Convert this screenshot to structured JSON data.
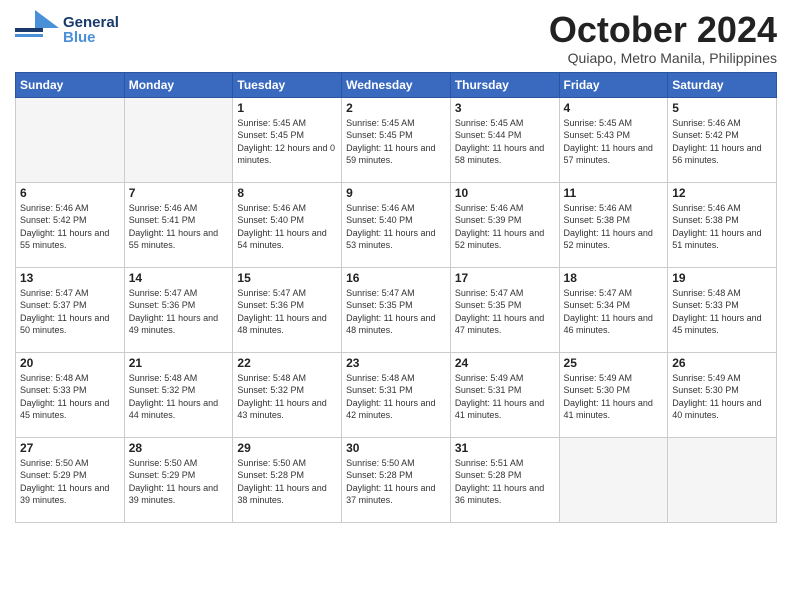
{
  "header": {
    "logo_general": "General",
    "logo_blue": "Blue",
    "title": "October 2024",
    "location": "Quiapo, Metro Manila, Philippines"
  },
  "weekdays": [
    "Sunday",
    "Monday",
    "Tuesday",
    "Wednesday",
    "Thursday",
    "Friday",
    "Saturday"
  ],
  "weeks": [
    [
      {
        "day": "",
        "sunrise": "",
        "sunset": "",
        "daylight": ""
      },
      {
        "day": "",
        "sunrise": "",
        "sunset": "",
        "daylight": ""
      },
      {
        "day": "1",
        "sunrise": "Sunrise: 5:45 AM",
        "sunset": "Sunset: 5:45 PM",
        "daylight": "Daylight: 12 hours and 0 minutes."
      },
      {
        "day": "2",
        "sunrise": "Sunrise: 5:45 AM",
        "sunset": "Sunset: 5:45 PM",
        "daylight": "Daylight: 11 hours and 59 minutes."
      },
      {
        "day": "3",
        "sunrise": "Sunrise: 5:45 AM",
        "sunset": "Sunset: 5:44 PM",
        "daylight": "Daylight: 11 hours and 58 minutes."
      },
      {
        "day": "4",
        "sunrise": "Sunrise: 5:45 AM",
        "sunset": "Sunset: 5:43 PM",
        "daylight": "Daylight: 11 hours and 57 minutes."
      },
      {
        "day": "5",
        "sunrise": "Sunrise: 5:46 AM",
        "sunset": "Sunset: 5:42 PM",
        "daylight": "Daylight: 11 hours and 56 minutes."
      }
    ],
    [
      {
        "day": "6",
        "sunrise": "Sunrise: 5:46 AM",
        "sunset": "Sunset: 5:42 PM",
        "daylight": "Daylight: 11 hours and 55 minutes."
      },
      {
        "day": "7",
        "sunrise": "Sunrise: 5:46 AM",
        "sunset": "Sunset: 5:41 PM",
        "daylight": "Daylight: 11 hours and 55 minutes."
      },
      {
        "day": "8",
        "sunrise": "Sunrise: 5:46 AM",
        "sunset": "Sunset: 5:40 PM",
        "daylight": "Daylight: 11 hours and 54 minutes."
      },
      {
        "day": "9",
        "sunrise": "Sunrise: 5:46 AM",
        "sunset": "Sunset: 5:40 PM",
        "daylight": "Daylight: 11 hours and 53 minutes."
      },
      {
        "day": "10",
        "sunrise": "Sunrise: 5:46 AM",
        "sunset": "Sunset: 5:39 PM",
        "daylight": "Daylight: 11 hours and 52 minutes."
      },
      {
        "day": "11",
        "sunrise": "Sunrise: 5:46 AM",
        "sunset": "Sunset: 5:38 PM",
        "daylight": "Daylight: 11 hours and 52 minutes."
      },
      {
        "day": "12",
        "sunrise": "Sunrise: 5:46 AM",
        "sunset": "Sunset: 5:38 PM",
        "daylight": "Daylight: 11 hours and 51 minutes."
      }
    ],
    [
      {
        "day": "13",
        "sunrise": "Sunrise: 5:47 AM",
        "sunset": "Sunset: 5:37 PM",
        "daylight": "Daylight: 11 hours and 50 minutes."
      },
      {
        "day": "14",
        "sunrise": "Sunrise: 5:47 AM",
        "sunset": "Sunset: 5:36 PM",
        "daylight": "Daylight: 11 hours and 49 minutes."
      },
      {
        "day": "15",
        "sunrise": "Sunrise: 5:47 AM",
        "sunset": "Sunset: 5:36 PM",
        "daylight": "Daylight: 11 hours and 48 minutes."
      },
      {
        "day": "16",
        "sunrise": "Sunrise: 5:47 AM",
        "sunset": "Sunset: 5:35 PM",
        "daylight": "Daylight: 11 hours and 48 minutes."
      },
      {
        "day": "17",
        "sunrise": "Sunrise: 5:47 AM",
        "sunset": "Sunset: 5:35 PM",
        "daylight": "Daylight: 11 hours and 47 minutes."
      },
      {
        "day": "18",
        "sunrise": "Sunrise: 5:47 AM",
        "sunset": "Sunset: 5:34 PM",
        "daylight": "Daylight: 11 hours and 46 minutes."
      },
      {
        "day": "19",
        "sunrise": "Sunrise: 5:48 AM",
        "sunset": "Sunset: 5:33 PM",
        "daylight": "Daylight: 11 hours and 45 minutes."
      }
    ],
    [
      {
        "day": "20",
        "sunrise": "Sunrise: 5:48 AM",
        "sunset": "Sunset: 5:33 PM",
        "daylight": "Daylight: 11 hours and 45 minutes."
      },
      {
        "day": "21",
        "sunrise": "Sunrise: 5:48 AM",
        "sunset": "Sunset: 5:32 PM",
        "daylight": "Daylight: 11 hours and 44 minutes."
      },
      {
        "day": "22",
        "sunrise": "Sunrise: 5:48 AM",
        "sunset": "Sunset: 5:32 PM",
        "daylight": "Daylight: 11 hours and 43 minutes."
      },
      {
        "day": "23",
        "sunrise": "Sunrise: 5:48 AM",
        "sunset": "Sunset: 5:31 PM",
        "daylight": "Daylight: 11 hours and 42 minutes."
      },
      {
        "day": "24",
        "sunrise": "Sunrise: 5:49 AM",
        "sunset": "Sunset: 5:31 PM",
        "daylight": "Daylight: 11 hours and 41 minutes."
      },
      {
        "day": "25",
        "sunrise": "Sunrise: 5:49 AM",
        "sunset": "Sunset: 5:30 PM",
        "daylight": "Daylight: 11 hours and 41 minutes."
      },
      {
        "day": "26",
        "sunrise": "Sunrise: 5:49 AM",
        "sunset": "Sunset: 5:30 PM",
        "daylight": "Daylight: 11 hours and 40 minutes."
      }
    ],
    [
      {
        "day": "27",
        "sunrise": "Sunrise: 5:50 AM",
        "sunset": "Sunset: 5:29 PM",
        "daylight": "Daylight: 11 hours and 39 minutes."
      },
      {
        "day": "28",
        "sunrise": "Sunrise: 5:50 AM",
        "sunset": "Sunset: 5:29 PM",
        "daylight": "Daylight: 11 hours and 39 minutes."
      },
      {
        "day": "29",
        "sunrise": "Sunrise: 5:50 AM",
        "sunset": "Sunset: 5:28 PM",
        "daylight": "Daylight: 11 hours and 38 minutes."
      },
      {
        "day": "30",
        "sunrise": "Sunrise: 5:50 AM",
        "sunset": "Sunset: 5:28 PM",
        "daylight": "Daylight: 11 hours and 37 minutes."
      },
      {
        "day": "31",
        "sunrise": "Sunrise: 5:51 AM",
        "sunset": "Sunset: 5:28 PM",
        "daylight": "Daylight: 11 hours and 36 minutes."
      },
      {
        "day": "",
        "sunrise": "",
        "sunset": "",
        "daylight": ""
      },
      {
        "day": "",
        "sunrise": "",
        "sunset": "",
        "daylight": ""
      }
    ]
  ]
}
